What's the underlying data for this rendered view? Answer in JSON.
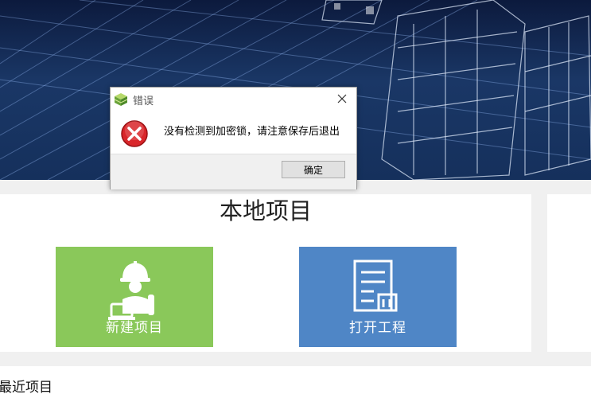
{
  "local_projects": {
    "title": "本地项目",
    "new_project_label": "新建项目",
    "open_project_label": "打开工程"
  },
  "recent_projects": {
    "title": "最近项目"
  },
  "dialog": {
    "title": "错误",
    "message": "没有检测到加密锁，请注意保存后退出",
    "ok_label": "确定"
  },
  "colors": {
    "new_tile": "#8ac85a",
    "open_tile": "#4f86c6",
    "error_red": "#d9262a"
  },
  "icons": {
    "dialog_app": "green-cube-icon",
    "dialog_error": "error-x-icon",
    "dialog_close": "close-icon",
    "new_project": "worker-helmet-icon",
    "open_project": "document-building-icon"
  }
}
